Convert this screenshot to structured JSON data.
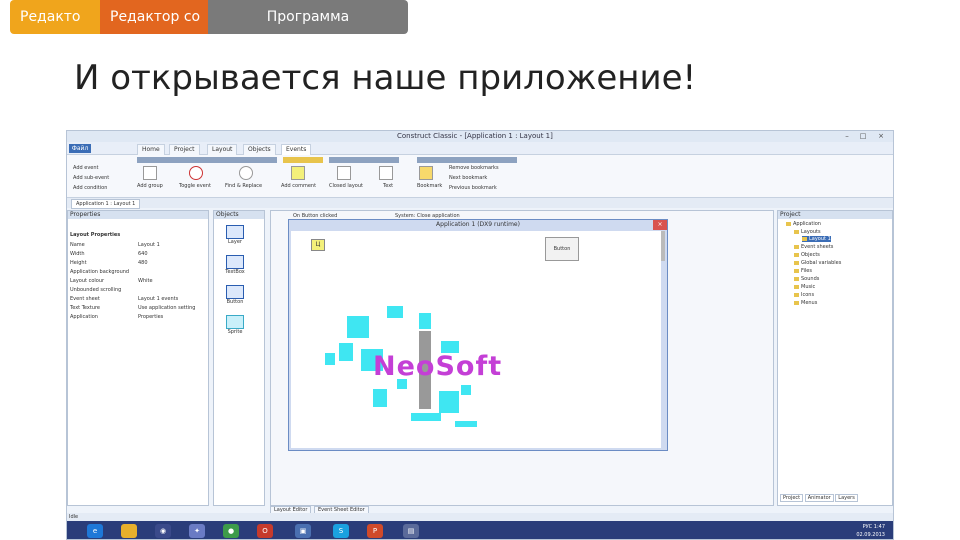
{
  "header_tabs": [
    "Редакто",
    "Редактор со",
    "Программа"
  ],
  "slide_title": "И открывается наше приложение!",
  "app": {
    "window_title": "Construct Classic - [Application 1 : Layout 1]",
    "file_label": "Файл",
    "menu_tabs": [
      "Home",
      "Project",
      "Layout",
      "Objects",
      "Events"
    ],
    "ribbon_items": [
      "Add event",
      "Add sub-event",
      "Add condition",
      "Add group",
      "Toggle event",
      "Find & Replace",
      "Add comment",
      "Closed layout",
      "Text",
      "Bookmark",
      "Remove bookmarks",
      "Next bookmark",
      "Previous bookmark"
    ],
    "doc_tab": "Application 1 : Layout 1",
    "properties_title": "Properties",
    "properties_section": "Layout Properties",
    "properties": [
      {
        "name": "Name",
        "value": "Layout 1"
      },
      {
        "name": "Width",
        "value": "640"
      },
      {
        "name": "Height",
        "value": "480"
      },
      {
        "name": "Application background",
        "value": ""
      },
      {
        "name": "Layout colour",
        "value": "White"
      },
      {
        "name": "Unbounded scrolling",
        "value": ""
      },
      {
        "name": "Event sheet",
        "value": "Layout 1 events"
      },
      {
        "name": "Text Texture",
        "value": "Use application setting"
      },
      {
        "name": "Application",
        "value": "Properties"
      }
    ],
    "objects_title": "Objects",
    "objects": [
      "Layer",
      "TextBox",
      "Button",
      "Sprite"
    ],
    "event_lines": [
      "On Button clicked",
      "System: Close application"
    ],
    "runtime_title": "Application 1 (DX9 runtime)",
    "runtime_button": "Button",
    "sprite_text": "Ц",
    "neo_text": "NeoSoft",
    "project_title": "Project",
    "tree": [
      "Application",
      "Layouts",
      "Layout 1",
      "Event sheets",
      "Objects",
      "Global variables",
      "Files",
      "Sounds",
      "Music",
      "Icons",
      "Menus"
    ],
    "bottom_tabs": [
      "Layout Editor",
      "Event Sheet Editor"
    ],
    "project_tabs": [
      "Project",
      "Animator",
      "Layers"
    ],
    "status_text": "Idle",
    "tray_time": "1:47",
    "tray_date": "02.09.2013",
    "tray_lang": "РУС"
  }
}
